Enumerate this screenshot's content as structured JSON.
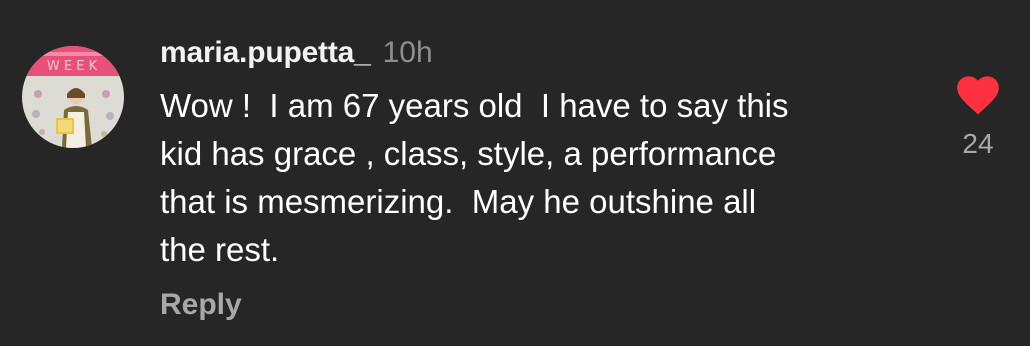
{
  "comment": {
    "username": "maria.pupetta_",
    "time": "10h",
    "text": "Wow !  I am 67 years old  I have to say this\nkid has grace , class, style, a performance\nthat is mesmerizing.  May he outshine all\nthe rest.",
    "reply_label": "Reply",
    "like_count": "24",
    "like_icon": "heart-filled-icon",
    "colors": {
      "background": "#262626",
      "username": "#f2f2f2",
      "text": "#ffffff",
      "muted": "#8e8e8e",
      "heart": "#ff3040"
    }
  }
}
